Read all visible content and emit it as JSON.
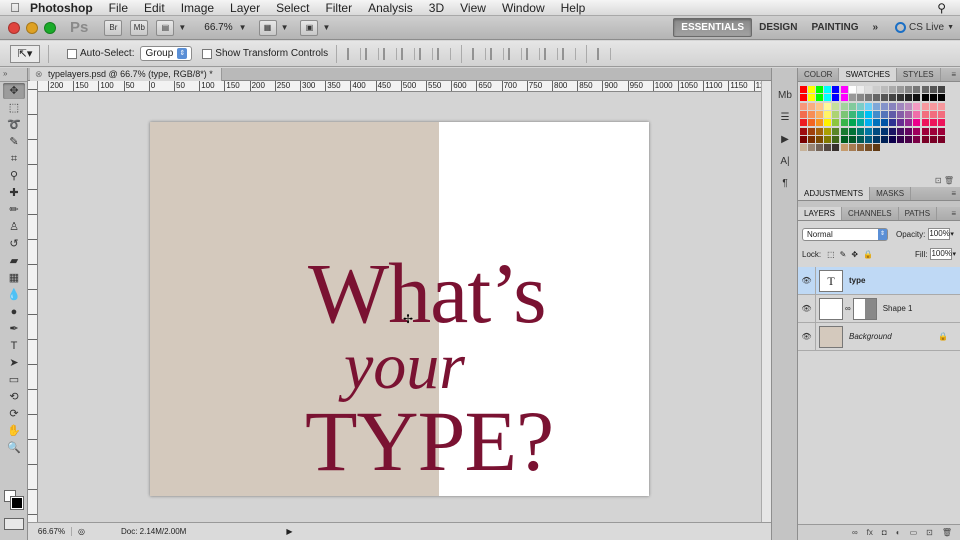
{
  "menubar": {
    "app": "Photoshop",
    "items": [
      "File",
      "Edit",
      "Image",
      "Layer",
      "Select",
      "Filter",
      "Analysis",
      "3D",
      "View",
      "Window",
      "Help"
    ]
  },
  "appbar": {
    "logo": "Ps",
    "zoom": "66.7%",
    "workspaces": [
      "ESSENTIALS",
      "DESIGN",
      "PAINTING"
    ],
    "more": "»",
    "cslive": "CS Live"
  },
  "options": {
    "auto_select_label": "Auto-Select:",
    "auto_select_value": "Group",
    "show_transform_label": "Show Transform Controls"
  },
  "document": {
    "tab_title": "typelayers.psd @ 66.7% (type, RGB/8*) *",
    "line1": "What’s",
    "line2": "your",
    "line3": "TYPE?",
    "text_color": "#7a1232",
    "shape_color": "#d4c9bd"
  },
  "ruler": {
    "h_labels": [
      "200",
      "150",
      "100",
      "50",
      "0",
      "50",
      "100",
      "150",
      "200",
      "250",
      "300",
      "350",
      "400",
      "450",
      "500",
      "550",
      "600",
      "650",
      "700",
      "750",
      "800",
      "850",
      "900",
      "950",
      "1000",
      "1050",
      "1100",
      "1150",
      "12"
    ]
  },
  "status": {
    "zoom": "66.67%",
    "doc_info": "Doc: 2.14M/2.00M"
  },
  "panels": {
    "top_tabs": [
      "COLOR",
      "SWATCHES",
      "STYLES"
    ],
    "adj_tabs": [
      "ADJUSTMENTS",
      "MASKS"
    ],
    "layer_tabs": [
      "LAYERS",
      "CHANNELS",
      "PATHS"
    ],
    "blend_mode": "Normal",
    "opacity_label": "Opacity:",
    "opacity": "100%",
    "lock_label": "Lock:",
    "fill_label": "Fill:",
    "fill": "100%",
    "layers": [
      {
        "name": "type",
        "thumb": "T"
      },
      {
        "name": "Shape 1",
        "thumb": ""
      },
      {
        "name": "Background",
        "thumb": ""
      }
    ]
  }
}
